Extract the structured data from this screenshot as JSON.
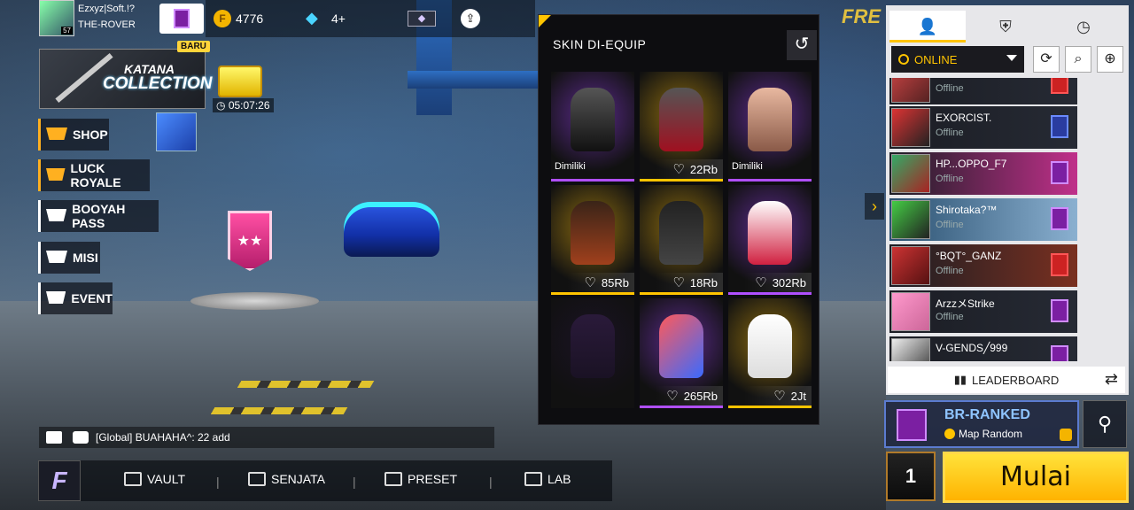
{
  "player": {
    "name": "Ezxyz|Soft.!?",
    "guild": "THE-ROVER",
    "level": "57"
  },
  "currency": {
    "coins": "4776",
    "diamonds": "4+"
  },
  "katana": {
    "new_badge": "BARU",
    "title_line1": "KATANA",
    "title_line2": "COLLECTION",
    "timer": "05:07:26"
  },
  "menu": {
    "shop": "SHOP",
    "luck_royale": "LUCK ROYALE",
    "booyah_pass": "BOOYAH PASS",
    "misi": "MISI",
    "event": "EVENT"
  },
  "chat": {
    "message": "[Global] BUAHAHA^: 22 add"
  },
  "bottom_nav": {
    "logo": "F",
    "vault": "VAULT",
    "senjata": "SENJATA",
    "preset": "PRESET",
    "lab": "LAB",
    "separator": "|"
  },
  "skin_panel": {
    "title": "SKIN DI-EQUIP",
    "back_icon": "↺",
    "items": [
      {
        "owned": "Dimiliki",
        "price": ""
      },
      {
        "owned": "",
        "price": "22Rb"
      },
      {
        "owned": "Dimiliki",
        "price": ""
      },
      {
        "owned": "",
        "price": "85Rb"
      },
      {
        "owned": "",
        "price": "18Rb"
      },
      {
        "owned": "",
        "price": "302Rb"
      },
      {
        "owned": "",
        "price": ""
      },
      {
        "owned": "",
        "price": "265Rb"
      },
      {
        "owned": "",
        "price": "2Jt"
      }
    ]
  },
  "friends_panel": {
    "status_filter": "ONLINE",
    "friends": [
      {
        "name": "",
        "status": "Offline"
      },
      {
        "name": "EXORCIST.",
        "status": "Offline"
      },
      {
        "name": "HP...OPPO_F7",
        "status": "Offline"
      },
      {
        "name": "Shirotaka?™",
        "status": "Offline"
      },
      {
        "name": "°BQT°_GANZ",
        "status": "Offline"
      },
      {
        "name": "ArzzメStrike",
        "status": "Offline"
      },
      {
        "name": "V-GENDS╱999",
        "status": ""
      }
    ],
    "leaderboard": "LEADERBOARD"
  },
  "mode": {
    "name": "BR-RANKED",
    "map": "Map Random"
  },
  "squad": {
    "count": "1"
  },
  "start": {
    "label": "Mulai"
  },
  "brand": "FRE",
  "colors": {
    "accent": "#ffc400",
    "start_button": "#ffcc1a",
    "panel_bg": "#0d0d10"
  }
}
